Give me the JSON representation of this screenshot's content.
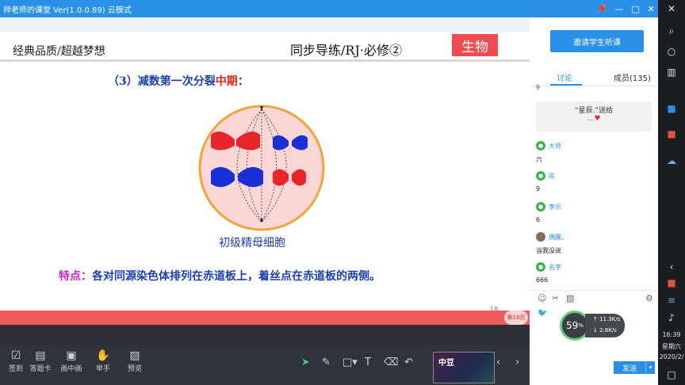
{
  "window": {
    "title": "师老师的课堂 Ver(1.0.0.89)  云模式",
    "controls": [
      "—",
      "✕"
    ]
  },
  "slide": {
    "header_left": "经典品质/超越梦想",
    "header_center": "同步导练/RJ·必修②",
    "badge": "生物",
    "subtitle_prefix": "（3）减数第一次分裂",
    "subtitle_highlight": "中期",
    "subtitle_suffix": "：",
    "cell_label": "初级精母细胞",
    "feature_label": "特点：",
    "feature_text": "各对同源染色体排列在赤道板上，着丝点在赤道板的两侧。",
    "page_number": "18",
    "page_badge": "第18页"
  },
  "toolbar": {
    "tools": [
      {
        "label": "签到",
        "icon": "calendar-check-icon"
      },
      {
        "label": "答题卡",
        "icon": "answer-card-icon"
      },
      {
        "label": "画中画",
        "icon": "picture-in-picture-icon"
      },
      {
        "label": "举手",
        "icon": "raise-hand-icon"
      },
      {
        "label": "预览",
        "icon": "preview-icon"
      }
    ],
    "thumbnail_label": "中豆"
  },
  "panel": {
    "invite_button": "邀请学生听课",
    "tab_discuss": "讨论",
    "tab_members": "成员(135)",
    "top_text": "9",
    "gift_line": "“星辰.”送给",
    "gift_sub": "…♥",
    "messages": [
      {
        "name": "大师",
        "text": "六"
      },
      {
        "name": "陈",
        "text": "9"
      },
      {
        "name": "李乐",
        "text": "6"
      },
      {
        "name": "偶醒。",
        "text": "当我没说"
      },
      {
        "name": "名字",
        "text": "666"
      }
    ],
    "send_button": "发送"
  },
  "speed": {
    "percent": "59",
    "percent_unit": "%",
    "up": "↑ 11.3K/s",
    "down": "↓ 2.8K/s"
  },
  "taskbar": {
    "time": "16:39",
    "weekday": "星期六",
    "date": "2020/2/"
  }
}
